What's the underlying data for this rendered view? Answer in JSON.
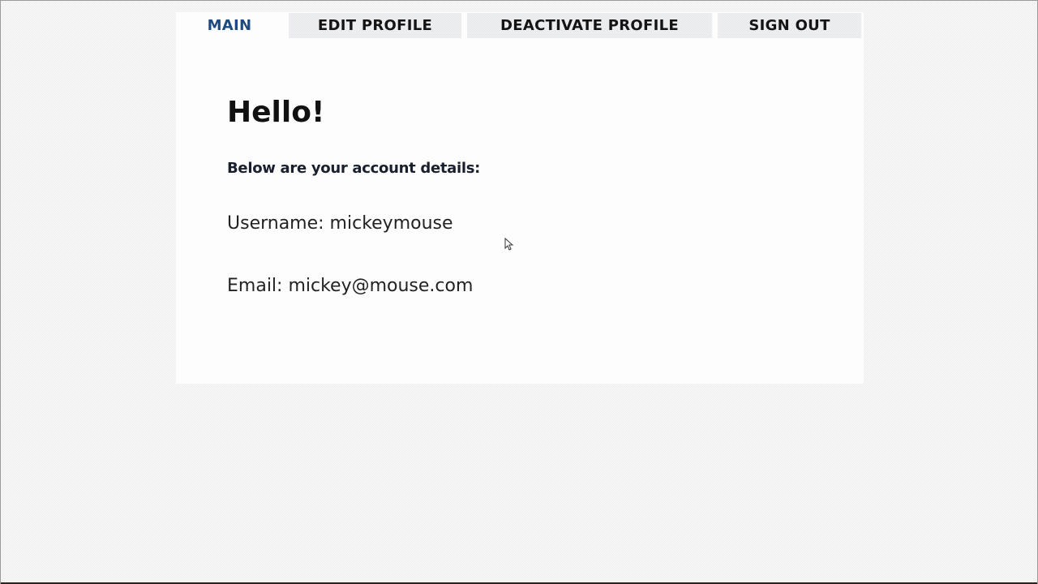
{
  "nav": {
    "tabs": [
      {
        "label": "MAIN",
        "active": true
      },
      {
        "label": "EDIT PROFILE",
        "active": false
      },
      {
        "label": "DEACTIVATE PROFILE",
        "active": false
      },
      {
        "label": "SIGN OUT",
        "active": false
      }
    ]
  },
  "main": {
    "greeting": "Hello!",
    "subheading": "Below are your account details:",
    "username_line": "Username: mickeymouse",
    "email_line": "Email: mickey@mouse.com"
  },
  "icons": {
    "cursor": "mouse-pointer-icon"
  },
  "colors": {
    "active_tab": "#1f4a7f",
    "inactive_tab_bg": "#e4e6ea",
    "text": "#111111",
    "page_bg": "#efefef",
    "card_bg": "#fdfdfd"
  }
}
